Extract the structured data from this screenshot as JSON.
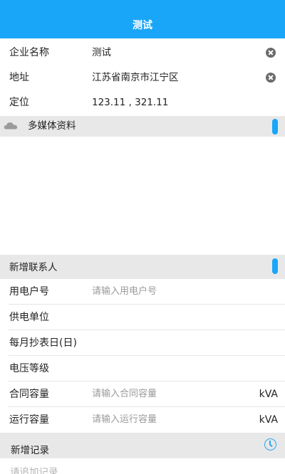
{
  "header": {
    "title": "测试"
  },
  "company_info": {
    "name": {
      "label": "企业名称",
      "value": "测试"
    },
    "address": {
      "label": "地址",
      "value": "江苏省南京市江宁区"
    },
    "location": {
      "label": "定位",
      "value": "123.11 , 321.11"
    }
  },
  "media_section": {
    "title": "多媒体资料",
    "icon": "cloud-icon",
    "toggle_color": "#1aa6f8"
  },
  "contact_section": {
    "title": "新增联系人",
    "fields": {
      "account_no": {
        "label": "用电户号",
        "placeholder": "请输入用电户号"
      },
      "supplier": {
        "label": "供电单位"
      },
      "meter_day": {
        "label": "每月抄表日(日)"
      },
      "voltage": {
        "label": "电压等级"
      },
      "contract_capacity": {
        "label": "合同容量",
        "placeholder": "请输入合同容量",
        "unit": "kVA"
      },
      "operating_capacity": {
        "label": "运行容量",
        "placeholder": "请输入运行容量",
        "unit": "kVA"
      }
    }
  },
  "record_section": {
    "title": "新增记录",
    "icon": "clock-icon",
    "placeholder": "请追加记录"
  },
  "colors": {
    "accent": "#1aa6f8",
    "section_bg": "#e8e8e8",
    "placeholder": "#9a9a9a"
  }
}
